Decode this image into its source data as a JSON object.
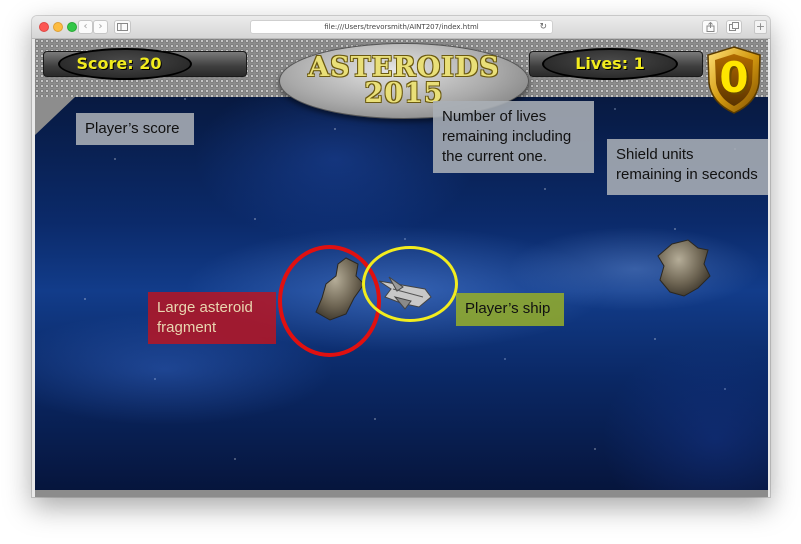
{
  "browser": {
    "url": "file:///Users/trevorsmith/AINT207/index.html",
    "back_icon": "‹",
    "forward_icon": "›",
    "reload_icon": "↻",
    "new_tab_icon": "+"
  },
  "hud": {
    "score_text": "Score:  20",
    "lives_text": "Lives:  1",
    "title_line1": "ASTEROIDS",
    "title_line2": "2015",
    "shield_value": "0"
  },
  "annotations": {
    "score": "Player’s score",
    "lives": "Number of lives remaining including the current one.",
    "shield": "Shield units remaining in seconds",
    "asteroid": "Large asteroid fragment",
    "ship": "Player’s ship"
  },
  "colors": {
    "hud_text": "#f2ec1e",
    "asteroid_marker": "#e01010",
    "ship_marker": "#f2ec1e"
  }
}
